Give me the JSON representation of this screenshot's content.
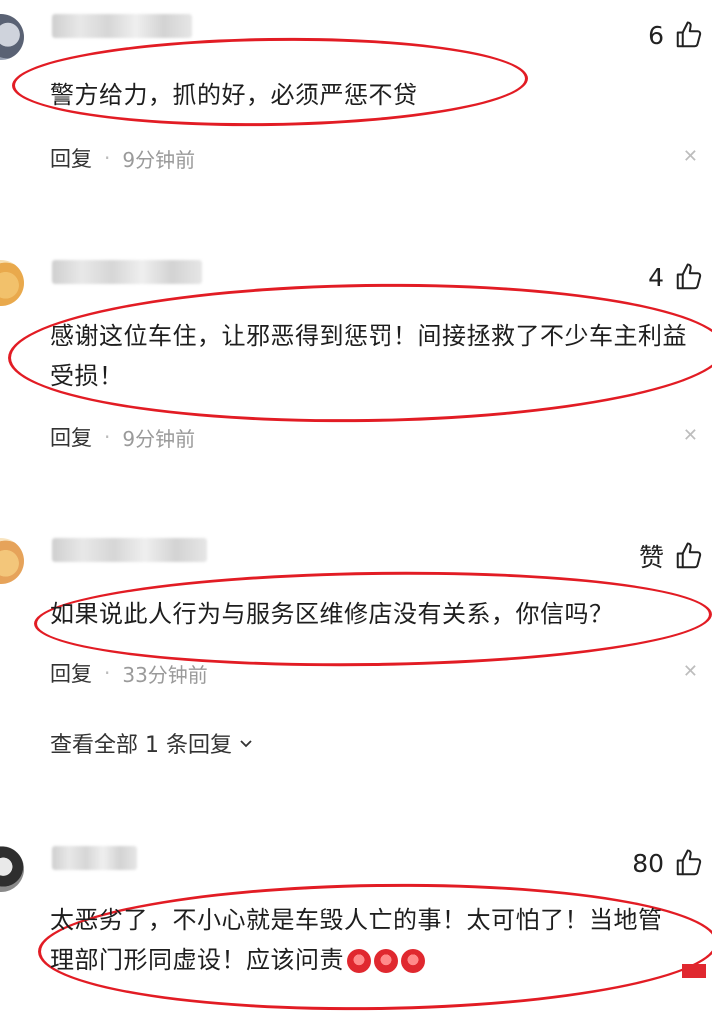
{
  "comments": [
    {
      "likes": "6",
      "text": "警方给力，抓的好，必须严惩不贷",
      "reply_label": "回复",
      "separator": "·",
      "time": "9分钟前",
      "close": "✕"
    },
    {
      "likes": "4",
      "text": "感谢这位车住，让邪恶得到惩罚！间接拯救了不少车主利益受损！",
      "reply_label": "回复",
      "separator": "·",
      "time": "9分钟前",
      "close": "✕"
    },
    {
      "likes": "赞",
      "text": "如果说此人行为与服务区维修店没有关系，你信吗？",
      "reply_label": "回复",
      "separator": "·",
      "time": "33分钟前",
      "close": "✕",
      "view_replies": "查看全部 1 条回复"
    },
    {
      "likes": "80",
      "text": "太恶劣了，不小心就是车毁人亡的事！太可怕了！当地管理部门形同虚设！应该问责"
    }
  ],
  "icons": {
    "like": "thumbs-up-icon",
    "close": "close-icon",
    "expand": "chevron-down-icon",
    "emoji": "angry-face-icon"
  },
  "colors": {
    "highlight": "#e21c24",
    "meta_text": "#9a9a9a",
    "body_text": "#1e1e1e"
  }
}
